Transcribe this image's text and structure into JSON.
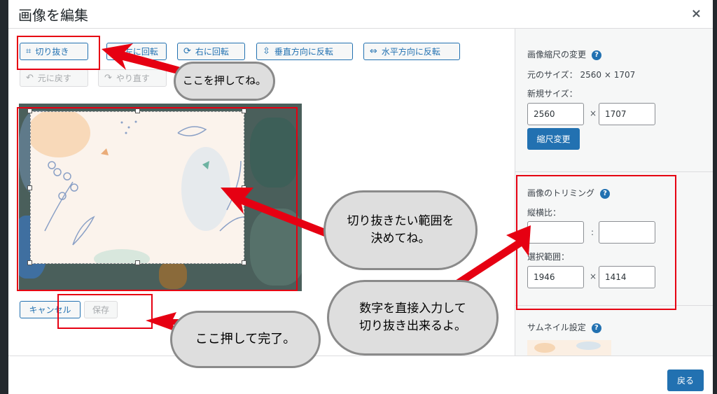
{
  "modal": {
    "title": "画像を編集",
    "close_symbol": "×"
  },
  "toolbar": {
    "crop_label": "切り抜き",
    "rotate_left_label": "左に回転",
    "rotate_right_label": "右に回転",
    "flip_vertical_label": "垂直方向に反転",
    "flip_horizontal_label": "水平方向に反転",
    "undo_label": "元に戻す",
    "redo_label": "やり直す"
  },
  "actions": {
    "cancel_label": "キャンセル",
    "save_label": "保存"
  },
  "sidebar": {
    "scale": {
      "heading": "画像縮尺の変更",
      "original_size_label": "元のサイズ：",
      "original_width": "2560",
      "times": "×",
      "original_height": "1707",
      "new_size_label": "新規サイズ：",
      "new_width": "2560",
      "new_height": "1707",
      "scale_button_label": "縮尺変更"
    },
    "crop": {
      "heading": "画像のトリミング",
      "aspect_label": "縦横比：",
      "aspect_width": "",
      "aspect_sep": ":",
      "aspect_height": "",
      "selection_label": "選択範囲：",
      "selection_width": "1946",
      "selection_height": "1414"
    },
    "thumbnail": {
      "heading": "サムネイル設定"
    }
  },
  "footer": {
    "back_label": "戻る"
  },
  "annotations": {
    "press_here": "ここを押してね。",
    "decide_range_line1": "切り抜きたい範囲を",
    "decide_range_line2": "決めてね。",
    "direct_input_line1": "数字を直接入力して",
    "direct_input_line2": "切り抜き出来るよ。",
    "press_to_finish": "ここ押して完了。"
  },
  "colors": {
    "accent": "#2271b1",
    "annotation_red": "#e60012",
    "bubble_fill": "#dedede",
    "bubble_border": "#8a8a8a"
  }
}
